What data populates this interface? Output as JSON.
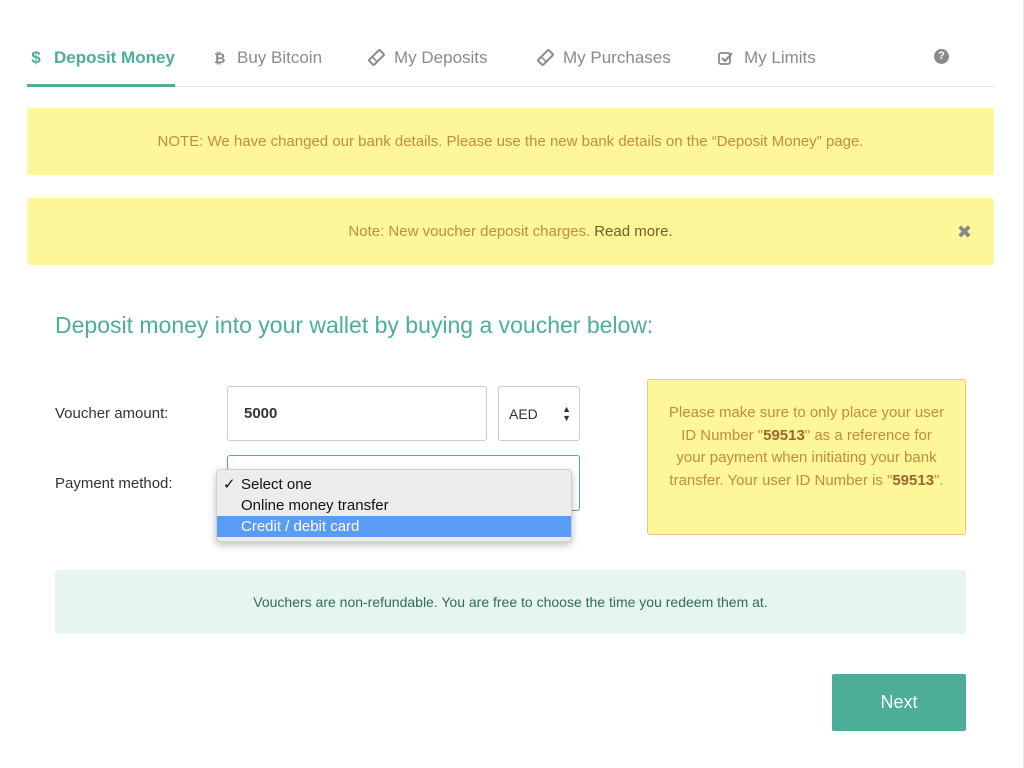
{
  "tabs": {
    "deposit": "Deposit Money",
    "bitcoin": "Buy Bitcoin",
    "deposits": "My Deposits",
    "purchases": "My Purchases",
    "limits": "My Limits",
    "help_glyph": "?"
  },
  "notices": {
    "bank_details": "NOTE: We have changed our bank details. Please use the new bank details on the “Deposit Money” page.",
    "voucher_text": "Note: New voucher deposit charges.",
    "voucher_link": "Read more.",
    "close_glyph": "✖"
  },
  "main": {
    "heading": "Deposit money into your wallet by buying a voucher below:",
    "amount_label": "Voucher amount:",
    "amount_value": "5000",
    "currency_value": "AED",
    "method_label": "Payment method:",
    "method_options": [
      "Select one",
      "Online money transfer",
      "Credit / debit card"
    ],
    "method_selected_index": 0,
    "method_highlight_index": 2
  },
  "info": {
    "part1": "Please make sure to only place your user ID Number \"",
    "user_id": "59513",
    "part2": "\" as a reference for your payment when initiating your bank transfer. Your user ID Number is \"",
    "user_id_2": "59513",
    "part3": "\"."
  },
  "refund_note": "Vouchers are non-refundable. You are free to choose the time you redeem them at.",
  "next_label": "Next",
  "colors": {
    "accent": "#4cae96",
    "notice_bg": "#fdf79a",
    "notice_text": "#c58a3e",
    "highlight": "#5a9bf5"
  }
}
